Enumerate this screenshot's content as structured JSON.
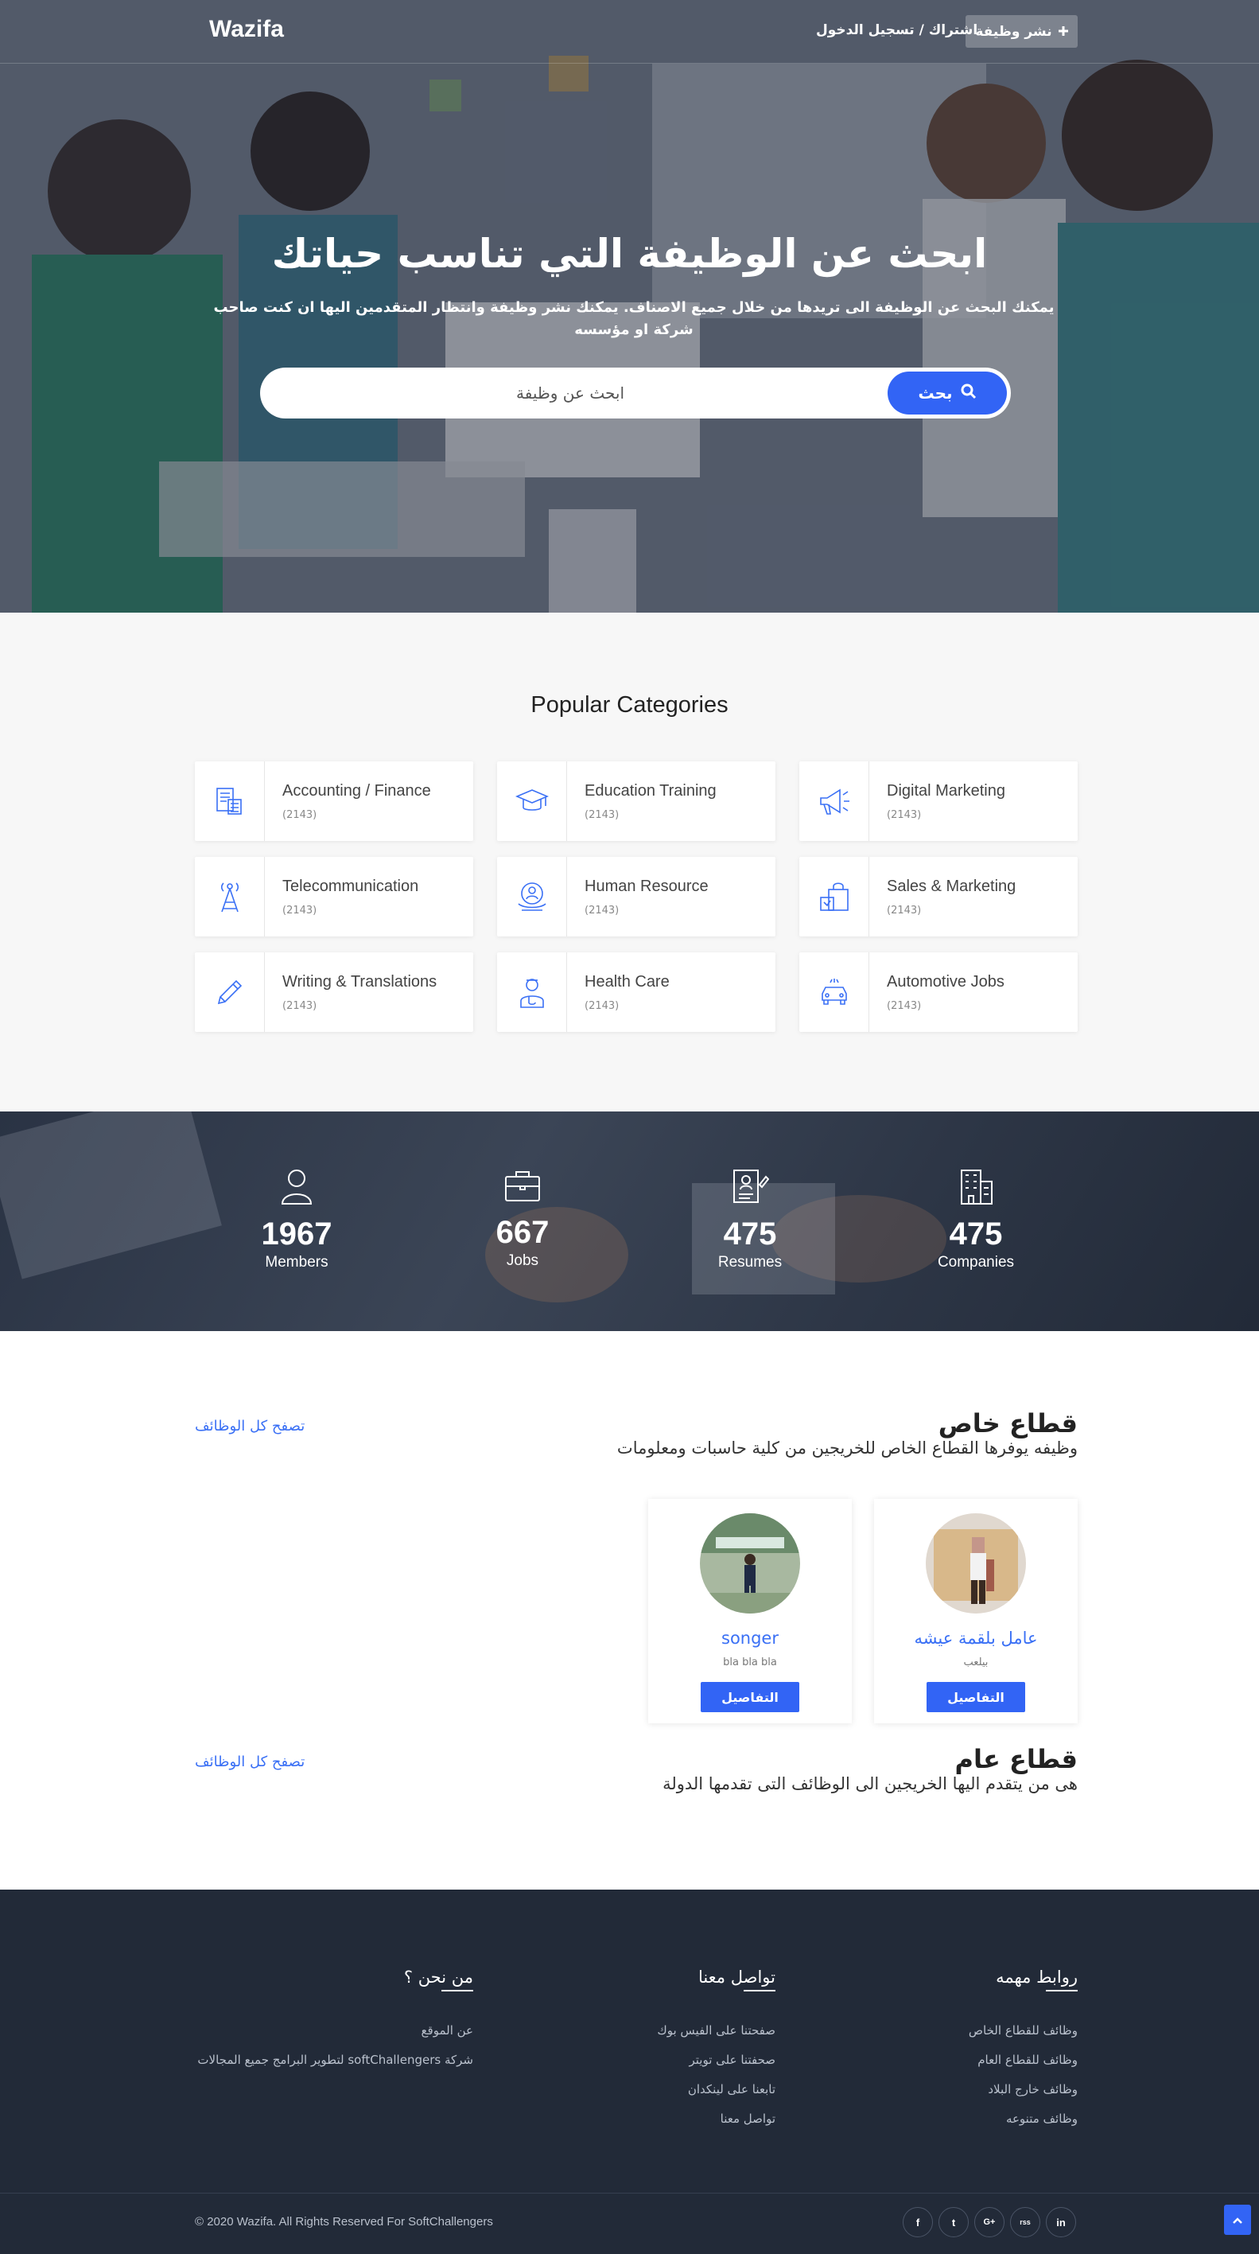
{
  "header": {
    "logo": "Wazifa",
    "auth_link": "اشتراك / تسجيل الدخول",
    "post_job_label": "نشر وظيفة",
    "post_job_icon": "plus-icon"
  },
  "hero": {
    "title": "ابحث عن الوظيفة التي تناسب حياتك",
    "subtitle": "يمكنك البحث عن الوظيفة الى تريدها من خلال جميع الاصناف. يمكنك نشر وظيفة وانتظار المتقدمين اليها ان كنت صاحب شركة او مؤسسه",
    "search_placeholder": "ابحث عن وظيفة",
    "search_button": "بحث",
    "search_icon": "search-icon"
  },
  "categories": {
    "title": "Popular Categories",
    "items": [
      {
        "name": "Accounting / Finance",
        "count": "(2143)",
        "icon": "accounting-icon"
      },
      {
        "name": "Education Training",
        "count": "(2143)",
        "icon": "graduation-cap-icon"
      },
      {
        "name": "Digital Marketing",
        "count": "(2143)",
        "icon": "megaphone-icon"
      },
      {
        "name": "Telecommunication",
        "count": "(2143)",
        "icon": "antenna-tower-icon"
      },
      {
        "name": "Human Resource",
        "count": "(2143)",
        "icon": "human-resource-icon"
      },
      {
        "name": "Sales & Marketing",
        "count": "(2143)",
        "icon": "shopping-bag-icon"
      },
      {
        "name": "Writing & Translations",
        "count": "(2143)",
        "icon": "pencil-icon"
      },
      {
        "name": "Health Care",
        "count": "(2143)",
        "icon": "doctor-icon"
      },
      {
        "name": "Automotive Jobs",
        "count": "(2143)",
        "icon": "car-icon"
      }
    ]
  },
  "stats": [
    {
      "number": "1967",
      "label": "Members",
      "icon": "user-icon"
    },
    {
      "number": "667",
      "label": "Jobs",
      "icon": "briefcase-icon"
    },
    {
      "number": "475",
      "label": "Resumes",
      "icon": "resume-icon"
    },
    {
      "number": "475",
      "label": "Companies",
      "icon": "building-icon"
    }
  ],
  "private_sector": {
    "title": "قطاع خاص",
    "description": "وظيفه يوفرها القطاع الخاص للخريجين من كلية حاسبات ومعلومات",
    "browse_link": "تصفح كل الوظائف",
    "jobs": [
      {
        "name": "عامل بلقمة عيشه",
        "desc": "بيلعب",
        "button": "التفاصيل"
      },
      {
        "name": "songer",
        "desc": "bla bla bla",
        "button": "التفاصيل"
      }
    ]
  },
  "public_sector": {
    "title": "قطاع عام",
    "description": "هى من يتقدم اليها الخريجين الى الوظائف التى تقدمها الدولة",
    "browse_link": "تصفح كل الوظائف"
  },
  "footer": {
    "columns": [
      {
        "title": "روابط مهمه",
        "links": [
          "وظائف للقطاع الخاص",
          "وظائف للقطاع العام",
          "وظائف خارج البلاد",
          "وظائف متنوعه"
        ]
      },
      {
        "title": "تواصل معنا",
        "links": [
          "صفحتنا على الفيس بوك",
          "صحفتنا على تويتر",
          "تابعنا على لينكدان",
          "تواصل معنا"
        ]
      },
      {
        "title": "من نحن ؟",
        "links": [
          "عن الموقع",
          "شركة softChallengers لتطوير البرامج جميع المجالات"
        ]
      }
    ],
    "copyright": "© 2020 Wazifa. All Rights Reserved For SoftChallengers",
    "social": [
      {
        "icon": "facebook-icon",
        "glyph": "f"
      },
      {
        "icon": "twitter-icon",
        "glyph": "t"
      },
      {
        "icon": "google-plus-icon",
        "glyph": "G+"
      },
      {
        "icon": "rss-icon",
        "glyph": "rss"
      },
      {
        "icon": "linkedin-icon",
        "glyph": "in"
      }
    ],
    "back_to_top_icon": "chevron-up-icon"
  },
  "colors": {
    "accent": "#3264f5",
    "link": "#3a70f5",
    "dark": "#222a38"
  }
}
